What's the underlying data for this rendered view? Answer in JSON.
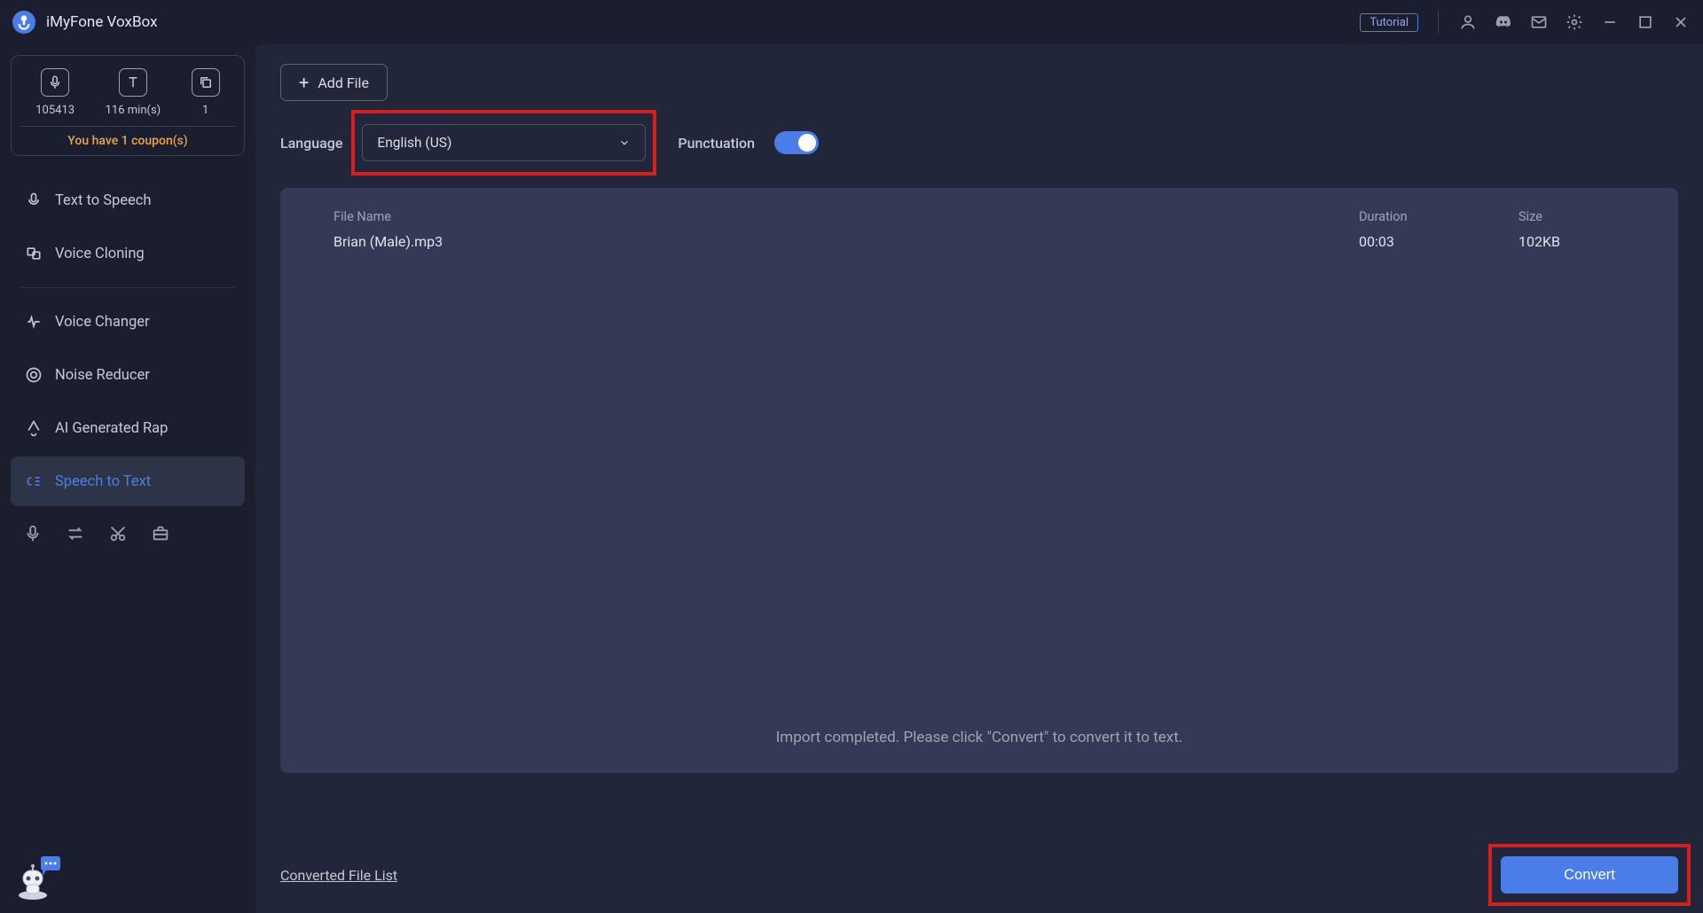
{
  "titlebar": {
    "app_name": "iMyFone VoxBox",
    "tutorial_label": "Tutorial"
  },
  "sidebar": {
    "stats": [
      {
        "value": "105413"
      },
      {
        "value": "116 min(s)"
      },
      {
        "value": "1"
      }
    ],
    "coupon_text": "You have 1 coupon(s)",
    "items": [
      {
        "label": "Text to Speech"
      },
      {
        "label": "Voice Cloning"
      },
      {
        "label": "Voice Changer"
      },
      {
        "label": "Noise Reducer"
      },
      {
        "label": "AI Generated Rap"
      },
      {
        "label": "Speech to Text"
      }
    ]
  },
  "main": {
    "add_file_label": "Add File",
    "language_label": "Language",
    "language_value": "English (US)",
    "punctuation_label": "Punctuation",
    "columns": {
      "name": "File Name",
      "duration": "Duration",
      "size": "Size"
    },
    "files": [
      {
        "name": "Brian (Male).mp3",
        "duration": "00:03",
        "size": "102KB"
      }
    ],
    "import_message": "Import completed. Please click \"Convert\" to convert it to text.",
    "converted_link": "Converted File List",
    "convert_label": "Convert"
  }
}
